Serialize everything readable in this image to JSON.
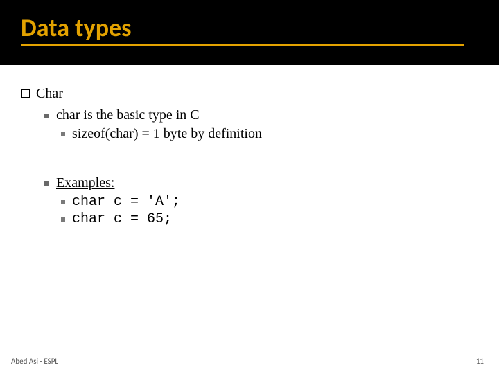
{
  "title": "Data types",
  "section": {
    "heading": "Char",
    "items": [
      {
        "text": "char is the basic type in C",
        "sub": [
          {
            "text": "sizeof(char)  = 1 byte by definition"
          }
        ]
      },
      {
        "text": "Examples:",
        "underline": true,
        "sub": [
          {
            "text": "char c = 'A';",
            "mono": true
          },
          {
            "text": "char c = 65;",
            "mono": true
          }
        ]
      }
    ]
  },
  "footer": {
    "left": "Abed Asi - ESPL",
    "right": "11"
  }
}
